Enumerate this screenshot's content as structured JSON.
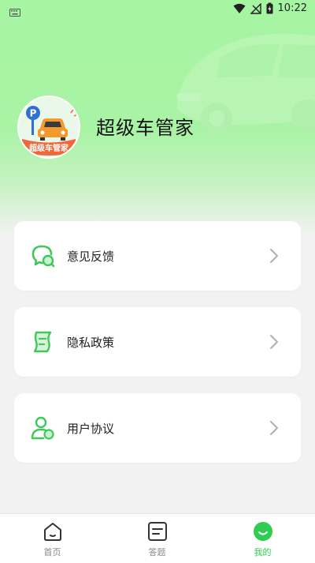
{
  "status_bar": {
    "time": "10:22",
    "icons": [
      "keyboard-icon",
      "wifi-icon",
      "no-signal-icon",
      "battery-charging-icon"
    ]
  },
  "profile": {
    "app_name": "超级车管家",
    "logo_text": "超级车管家",
    "logo_parking_letter": "P"
  },
  "menu": {
    "items": [
      {
        "label": "意见反馈",
        "icon": "feedback-chat-icon"
      },
      {
        "label": "隐私政策",
        "icon": "document-scroll-icon"
      },
      {
        "label": "用户协议",
        "icon": "user-agreement-icon"
      }
    ]
  },
  "bottom_nav": {
    "items": [
      {
        "label": "首页",
        "icon": "home-icon",
        "active": false
      },
      {
        "label": "答题",
        "icon": "quiz-icon",
        "active": false
      },
      {
        "label": "我的",
        "icon": "smile-profile-icon",
        "active": true
      }
    ]
  },
  "colors": {
    "accent": "#2ecc51",
    "icon_green": "#3ec95a",
    "header_green": "#a6f5a3",
    "background": "#f2f2f2",
    "logo_car": "#f29a2e",
    "logo_banner": "#f0673a",
    "parking_blue": "#2f6fd6"
  }
}
